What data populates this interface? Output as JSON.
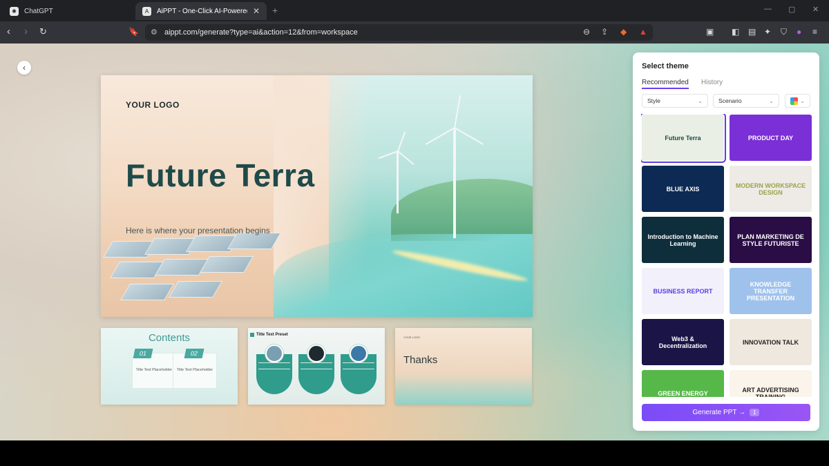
{
  "browser": {
    "tabs": [
      {
        "title": "ChatGPT",
        "active": false
      },
      {
        "title": "AiPPT - One-Click AI-Powered S",
        "active": true
      }
    ],
    "url": "aippt.com/generate?type=ai&action=12&from=workspace"
  },
  "slide": {
    "logo": "YOUR LOGO",
    "title": "Future Terra",
    "subtitle": "Here is where your presentation begins"
  },
  "thumbnails": {
    "contents": {
      "title": "Contents",
      "items": [
        {
          "num": "01",
          "label": "Title Text Placeholder"
        },
        {
          "num": "02",
          "label": "Title Text Placeholder"
        }
      ]
    },
    "preset": {
      "title": "Title Text Preset"
    },
    "thanks": {
      "logo": "YOUR LOGO",
      "title": "Thanks"
    }
  },
  "theme_panel": {
    "title": "Select theme",
    "tabs": [
      "Recommended",
      "History"
    ],
    "filters": {
      "style": "Style",
      "scenario": "Scenario"
    },
    "themes": [
      {
        "label": "Future Terra",
        "selected": true,
        "bg": "#e9efe4",
        "color": "#1f4a4a"
      },
      {
        "label": "PRODUCT DAY",
        "selected": false,
        "bg": "#7b2fd6",
        "color": "#ffffff"
      },
      {
        "label": "BLUE AXIS",
        "selected": false,
        "bg": "#0d2a54",
        "color": "#ffffff"
      },
      {
        "label": "MODERN WORKSPACE DESIGN",
        "selected": false,
        "bg": "#eeebe6",
        "color": "#9aa24a"
      },
      {
        "label": "Introduction to Machine Learning",
        "selected": false,
        "bg": "#0f2e3c",
        "color": "#ffffff"
      },
      {
        "label": "PLAN MARKETING DE STYLE FUTURISTE",
        "selected": false,
        "bg": "#2a0d45",
        "color": "#ffffff"
      },
      {
        "label": "BUSINESS REPORT",
        "selected": false,
        "bg": "#f2f1fb",
        "color": "#5b3ce6"
      },
      {
        "label": "KNOWLEDGE TRANSFER PRESENTATION",
        "selected": false,
        "bg": "#9fc2ec",
        "color": "#ffffff"
      },
      {
        "label": "Web3 & Decentralization",
        "selected": false,
        "bg": "#1a1546",
        "color": "#ffffff"
      },
      {
        "label": "INNOVATION TALK",
        "selected": false,
        "bg": "#efe8df",
        "color": "#222222"
      },
      {
        "label": "GREEN ENERGY",
        "selected": false,
        "bg": "#57b84a",
        "color": "#ffffff"
      },
      {
        "label": "ART ADVERTISING TRAINING",
        "selected": false,
        "bg": "#fbf4ea",
        "color": "#222222"
      }
    ],
    "generate": {
      "label": "Generate PPT →",
      "badge": "1"
    }
  }
}
